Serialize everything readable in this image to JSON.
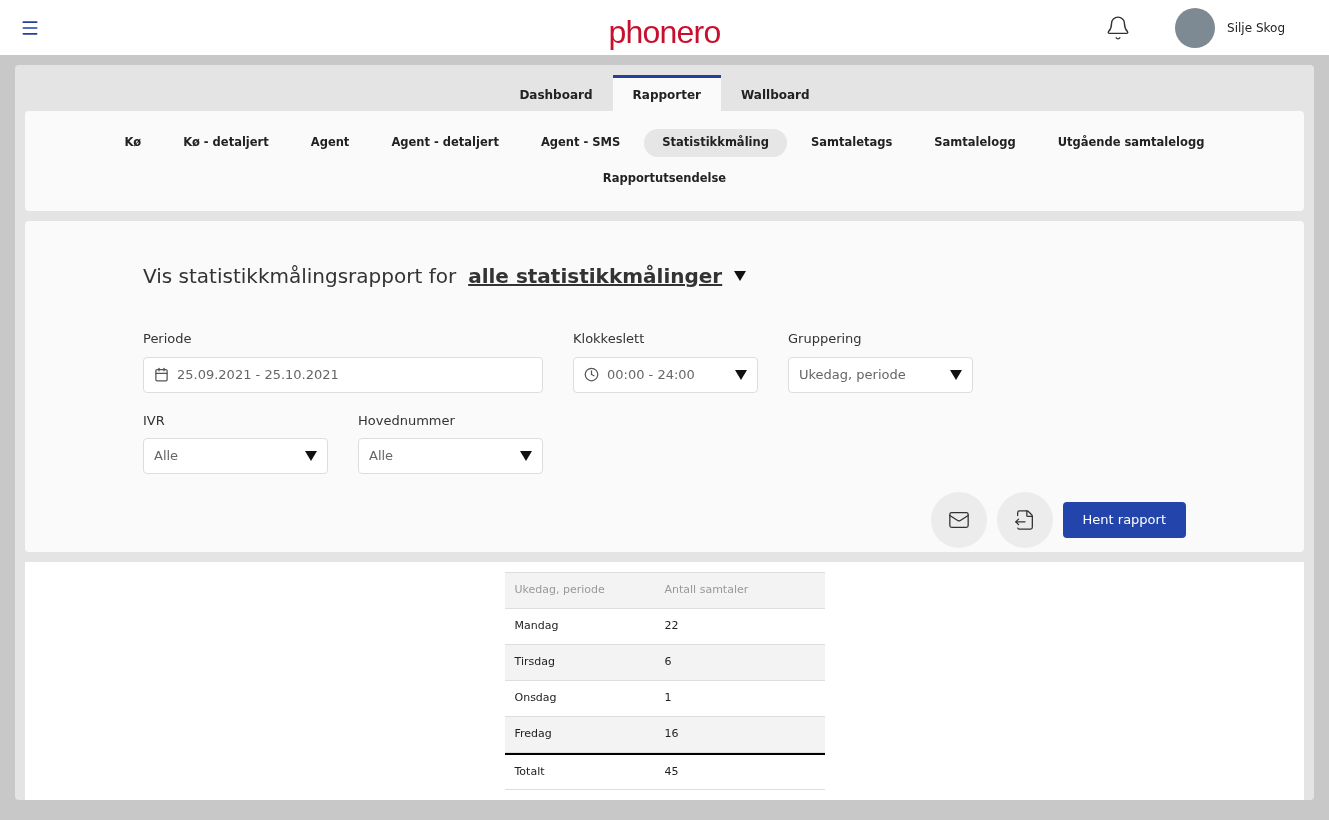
{
  "header": {
    "logo": "phonero",
    "user": {
      "name": "Silje Skog"
    }
  },
  "main_tabs": [
    {
      "label": "Dashboard",
      "selected": false
    },
    {
      "label": "Rapporter",
      "selected": true
    },
    {
      "label": "Wallboard",
      "selected": false
    }
  ],
  "report_tabs": [
    {
      "label": "Kø",
      "selected": false
    },
    {
      "label": "Kø - detaljert",
      "selected": false
    },
    {
      "label": "Agent",
      "selected": false
    },
    {
      "label": "Agent - detaljert",
      "selected": false
    },
    {
      "label": "Agent - SMS",
      "selected": false
    },
    {
      "label": "Statistikkmåling",
      "selected": true
    },
    {
      "label": "Samtaletags",
      "selected": false
    },
    {
      "label": "Samtalelogg",
      "selected": false
    },
    {
      "label": "Utgående samtalelogg",
      "selected": false
    },
    {
      "label": "Rapportutsendelse",
      "selected": false
    }
  ],
  "form": {
    "heading": "Vis statistikkmålingsrapport for",
    "heading_link": "alle statistikkmålinger",
    "fields": [
      {
        "label": "Periode",
        "kind": "date",
        "value": "25.09.2021 - 25.10.2021"
      },
      {
        "label": "Klokkeslett",
        "kind": "time",
        "value": "00:00 - 24:00"
      },
      {
        "label": "Gruppering",
        "kind": "select",
        "value": "Ukedag, periode"
      },
      {
        "label": "IVR",
        "kind": "select",
        "value": "Alle"
      },
      {
        "label": "Hovednummer",
        "kind": "select",
        "value": "Alle"
      }
    ],
    "submit": "Hent rapport"
  },
  "table": {
    "columns": [
      "Ukedag, periode",
      "Antall samtaler"
    ],
    "rows": [
      {
        "cells": [
          "Mandag",
          "22"
        ],
        "kind": "data"
      },
      {
        "cells": [
          "Tirsdag",
          "6"
        ],
        "kind": "data"
      },
      {
        "cells": [
          "Onsdag",
          "1"
        ],
        "kind": "data"
      },
      {
        "cells": [
          "Fredag",
          "16"
        ],
        "kind": "data"
      },
      {
        "cells": [
          "Totalt",
          "45"
        ],
        "kind": "total"
      }
    ]
  }
}
